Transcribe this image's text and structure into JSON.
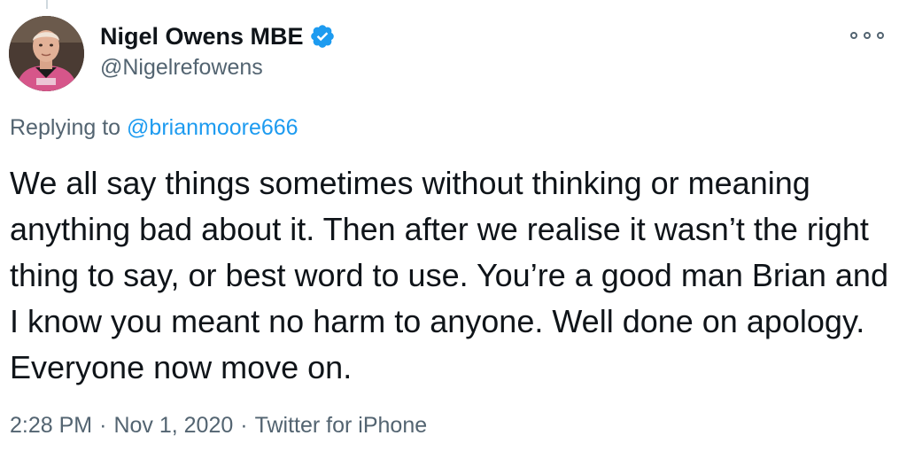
{
  "author": {
    "display_name": "Nigel Owens MBE",
    "handle": "@Nigelrefowens",
    "verified": true,
    "avatar_icon": "referee-portrait"
  },
  "reply": {
    "prefix": "Replying to",
    "mention": "@brianmoore666"
  },
  "tweet": {
    "text": "We all say things sometimes without thinking or meaning anything bad about it. Then after we realise it wasn’t the right thing to say, or best word to use. You’re a good man Brian and I know you meant no harm to anyone. Well done on apology. Everyone now move on."
  },
  "meta": {
    "time": "2:28 PM",
    "date": "Nov 1, 2020",
    "source": "Twitter for iPhone",
    "separator": "·"
  },
  "colors": {
    "text": "#0f1419",
    "secondary": "#536471",
    "link": "#1d9bf0",
    "verified_badge": "#1d9bf0",
    "jersey": "#d6568a"
  },
  "icons": {
    "verified": "verified-badge-icon",
    "more": "more-options-icon"
  }
}
